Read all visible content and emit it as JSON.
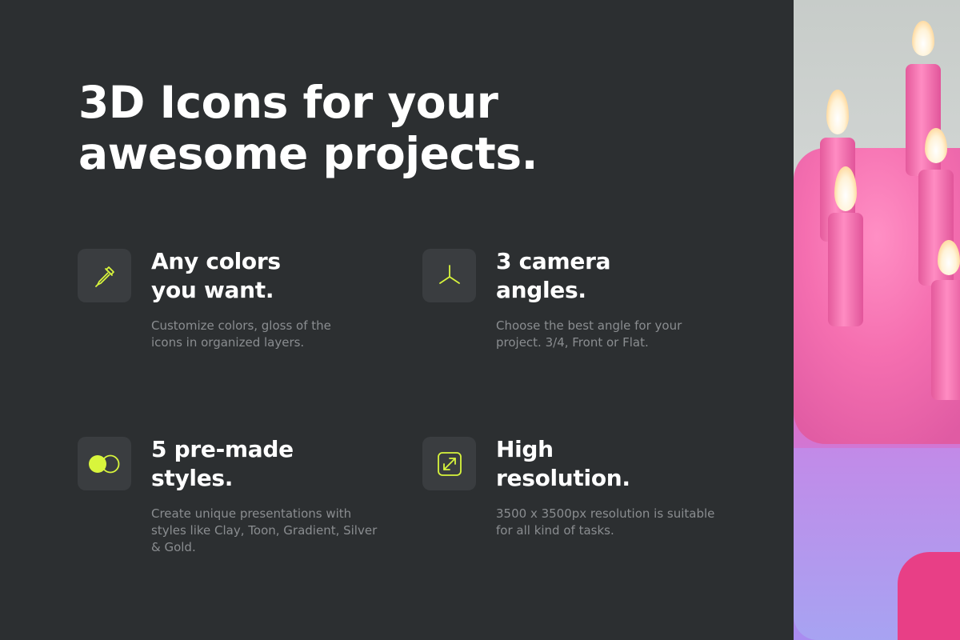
{
  "headline": {
    "line1": "3D Icons for your",
    "line2": "awesome projects."
  },
  "features": [
    {
      "icon": "eyedropper-icon",
      "title_line1": "Any colors",
      "title_line2": "you want.",
      "desc_line1": "Customize colors, gloss of the",
      "desc_line2": "icons in organized layers."
    },
    {
      "icon": "camera-angles-icon",
      "title_line1": "3 camera",
      "title_line2": "angles.",
      "desc_line1": "Choose the best angle for your",
      "desc_line2": "project. 3/4, Front or Flat."
    },
    {
      "icon": "styles-circles-icon",
      "title_line1": "5 pre-made",
      "title_line2": "styles.",
      "desc_line1": "Create unique presentations with",
      "desc_line2": "styles like Clay, Toon, Gradient, Silver",
      "desc_line3": "& Gold."
    },
    {
      "icon": "resize-arrow-icon",
      "title_line1": "High",
      "title_line2": "resolution.",
      "desc_line1": "3500 x 3500px resolution is suitable",
      "desc_line2": "for all kind of tasks."
    }
  ],
  "colors": {
    "background": "#2c2f31",
    "icon_tile": "#3a3d40",
    "accent": "#d8f53c",
    "title": "#ffffff",
    "description": "#8a8d90"
  },
  "image": {
    "subject": "birthday-cake-with-candles"
  }
}
